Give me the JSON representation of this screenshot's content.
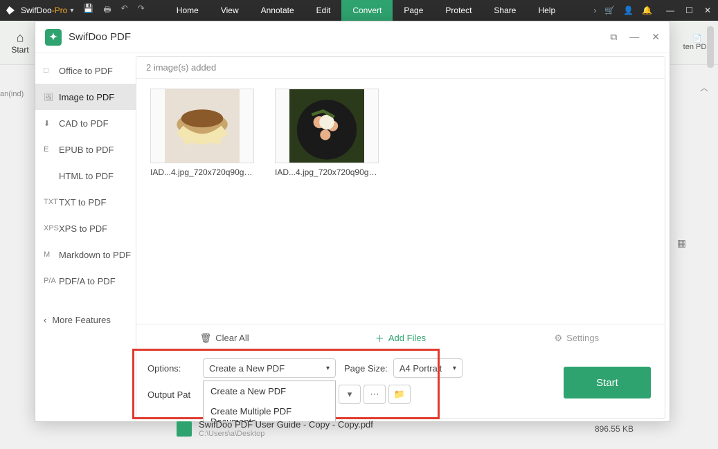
{
  "titlebar": {
    "app_prefix": "SwifDoo",
    "app_suffix": "-Pro",
    "menus": [
      "Home",
      "View",
      "Annotate",
      "Edit",
      "Convert",
      "Page",
      "Protect",
      "Share",
      "Help"
    ],
    "active_menu_index": 4
  },
  "subbar": {
    "start": "Start",
    "flatten": "ten PDF"
  },
  "sidetext": "an(ind)",
  "dialog": {
    "title": "SwifDoo PDF",
    "status": "2 image(s) added",
    "sidebar": [
      {
        "icon": "□",
        "label": "Office to PDF"
      },
      {
        "icon": "🖼",
        "label": "Image to PDF"
      },
      {
        "icon": "⬇",
        "label": "CAD to PDF"
      },
      {
        "icon": "E",
        "label": "EPUB to PDF"
      },
      {
        "icon": "</>",
        "label": "HTML to PDF"
      },
      {
        "icon": "TXT",
        "label": "TXT to PDF"
      },
      {
        "icon": "XPS",
        "label": "XPS to PDF"
      },
      {
        "icon": "M",
        "label": "Markdown to PDF"
      },
      {
        "icon": "P/A",
        "label": "PDF/A to PDF"
      }
    ],
    "active_sidebar_index": 1,
    "more_features": "More Features",
    "thumbs": [
      {
        "caption": "IAD...4.jpg_720x720q90g.jpg"
      },
      {
        "caption": "IAD...4.jpg_720x720q90g.jpg"
      }
    ],
    "midbar": {
      "clear": "Clear All",
      "add": "Add Files",
      "settings": "Settings"
    },
    "bottom": {
      "options_label": "Options:",
      "options_value": "Create a New PDF",
      "pagesize_label": "Page Size:",
      "pagesize_value": "A4 Portrait",
      "output_label": "Output Pat",
      "dropdown": [
        "Create a New PDF",
        "Create Multiple PDF Documents"
      ],
      "start": "Start"
    }
  },
  "filerow": {
    "name": "SwifDoo PDF User Guide - Copy - Copy.pdf",
    "path": "C:\\Users\\a\\Desktop",
    "size": "896.55 KB"
  }
}
